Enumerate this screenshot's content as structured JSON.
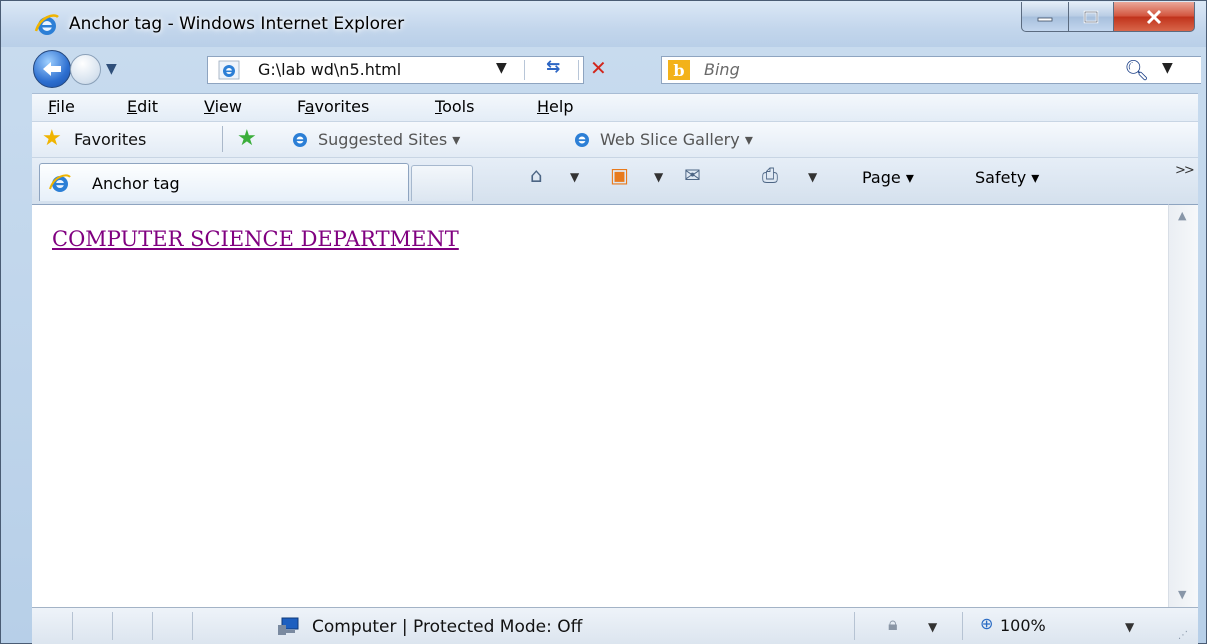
{
  "window": {
    "title": "Anchor tag - Windows Internet Explorer",
    "minimize_glyph": "—",
    "maximize_glyph": "□",
    "close_glyph": "✕"
  },
  "address_bar": {
    "url": "G:\\lab wd\\n5.html",
    "dropdown_glyph": "▾"
  },
  "search": {
    "placeholder": "Bing",
    "search_glyph": "⚲"
  },
  "menu": {
    "items": [
      "File",
      "Edit",
      "View",
      "Favorites",
      "Tools",
      "Help"
    ],
    "underlined_letters": [
      "F",
      "E",
      "V",
      "a",
      "T",
      "H"
    ]
  },
  "favorites_bar": {
    "favorites_label": "Favorites",
    "links": [
      "Suggested Sites ▾",
      "Web Slice Gallery ▾"
    ]
  },
  "tabs": [
    {
      "label": "Anchor tag",
      "active": true
    }
  ],
  "command_bar": {
    "page_label": "Page",
    "safety_label": "Safety",
    "more_glyph": ">>"
  },
  "content": {
    "link_text": "COMPUTER SCIENCE DEPARTMENT",
    "link_color": "#800080"
  },
  "status_bar": {
    "zone_text": "Computer | Protected Mode: Off",
    "zoom_text": "100%"
  },
  "colors": {
    "frame": "#c3d6ec",
    "close_button": "#c0321b",
    "visited_link": "#800080"
  }
}
